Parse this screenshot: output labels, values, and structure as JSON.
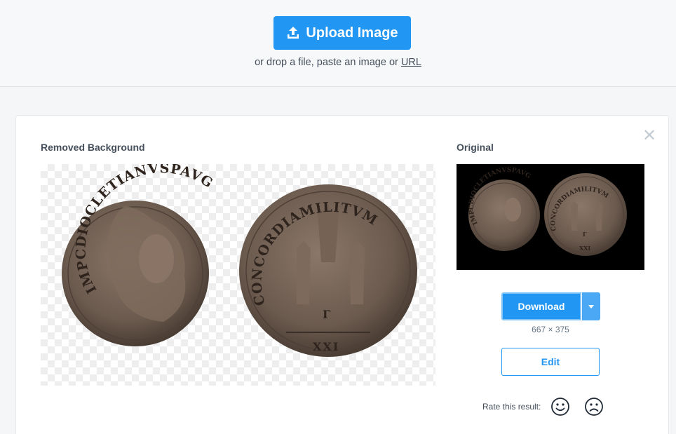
{
  "header": {
    "upload_label": "Upload Image",
    "drop_prefix": "or drop a file, paste an image or ",
    "drop_link": "URL"
  },
  "result": {
    "removed_label": "Removed Background",
    "original_label": "Original",
    "close_icon": "close-icon",
    "download_label": "Download",
    "dimensions": "667 × 375",
    "edit_label": "Edit",
    "rate_label": "Rate this result:",
    "rate_icons": [
      "smile-icon",
      "frown-icon"
    ]
  },
  "image": {
    "left_coin_legend": "IMPCDIOCLETIANVSPAVG",
    "right_coin_legend": "CONCORDIAMILITVM",
    "right_coin_mark": "Γ",
    "right_coin_exergue": "XXI"
  },
  "colors": {
    "accent": "#2196f3",
    "coin_bronze": "#6b5a4e"
  }
}
